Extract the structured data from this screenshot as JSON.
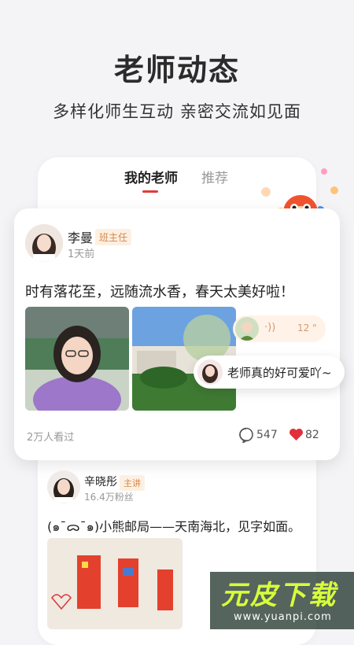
{
  "header": {
    "title": "老师动态",
    "subtitle": "多样化师生互动 亲密交流如见面"
  },
  "tabs": [
    {
      "label": "我的老师",
      "active": true
    },
    {
      "label": "推荐",
      "active": false
    }
  ],
  "colors": {
    "accent": "#e23a3a",
    "tag_text": "#d4894a",
    "tag_bg": "#fdf0e2",
    "watermark_text": "#d7ff3a"
  },
  "post1": {
    "author": "李曼",
    "role": "班主任",
    "time": "1天前",
    "text": "时有落花至，远随流水香，春天太美好啦！",
    "views": "2万人看过",
    "comments": "547",
    "likes": "82",
    "icons": {
      "comment": "comment-icon",
      "like": "heart-icon"
    }
  },
  "voice_message": {
    "duration": "12 \""
  },
  "comment_bubble": {
    "text": "老师真的好可爱吖~"
  },
  "post2": {
    "author": "辛晓彤",
    "role": "主讲",
    "followers": "16.4万粉丝",
    "text": "(๑¯ᯅ¯๑)小熊邮局——天南海北，见字如面。"
  },
  "watermark": {
    "title": "元皮下载",
    "url": "www.yuanpi.com"
  }
}
